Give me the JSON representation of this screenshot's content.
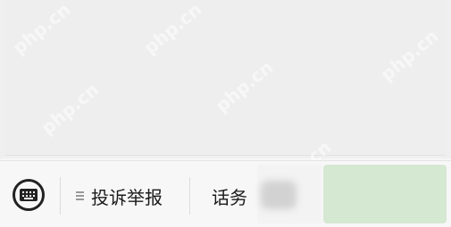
{
  "watermarks": [
    "php.cn",
    "php.cn",
    "php.cn",
    "php.cn",
    "php.cn",
    "php.cn"
  ],
  "bottom_menu": {
    "keyboard_icon": "keyboard-icon",
    "items": [
      {
        "icon": "menu-lines-icon",
        "label": "投诉举报"
      },
      {
        "label": "话务"
      }
    ]
  },
  "colors": {
    "menu_text": "#1a1a1a",
    "green_block": "#d5e8d2"
  }
}
